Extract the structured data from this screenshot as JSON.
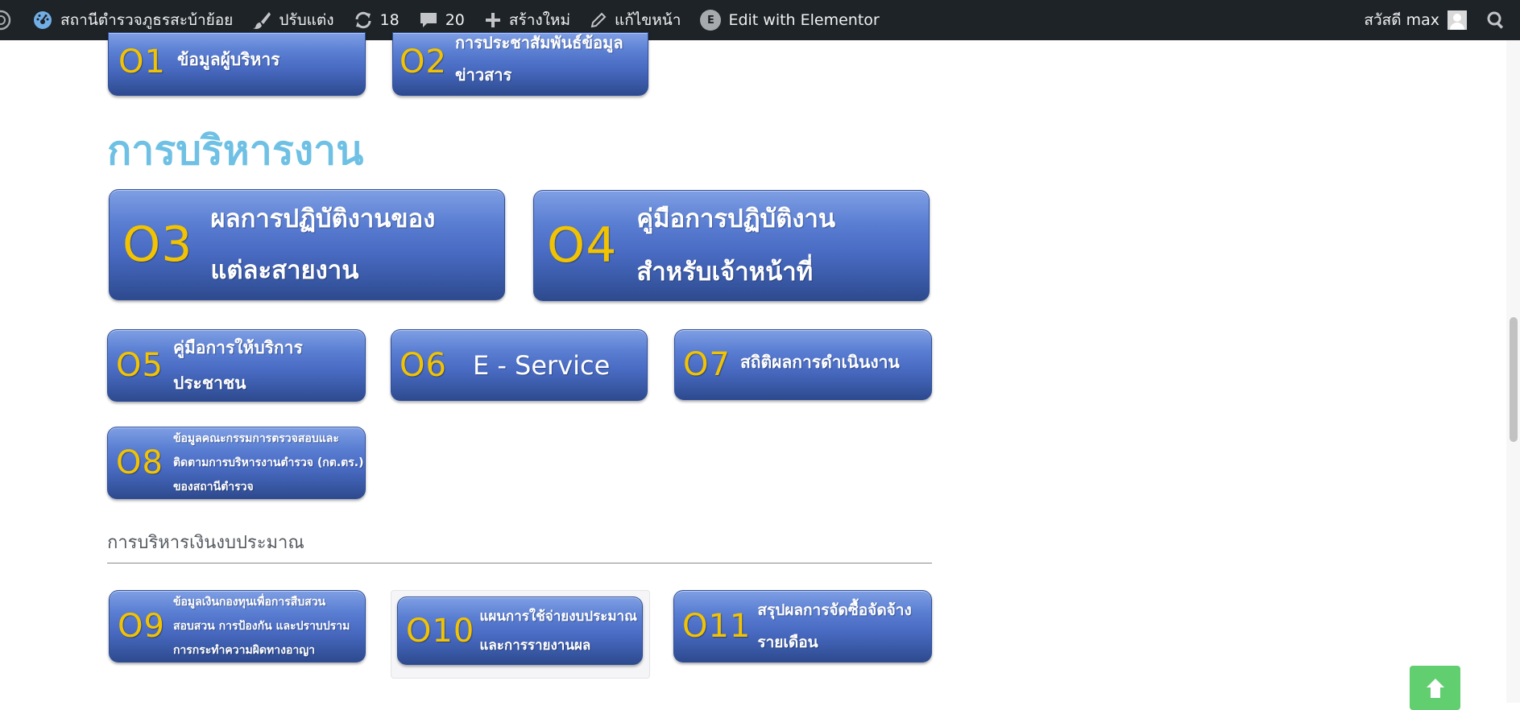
{
  "adminbar": {
    "site_name": "สถานีตำรวจภูธรสะบ้าย้อย",
    "customize": "ปรับแต่ง",
    "updates_count": "18",
    "comments_count": "20",
    "new": "สร้างใหม่",
    "edit_page": "แก้ไขหน้า",
    "elementor": "Edit with Elementor",
    "greeting": "สวัสดี max",
    "icons": [
      "wordpress-icon",
      "dashboard-icon",
      "brush-icon",
      "updates-icon",
      "comment-icon",
      "plus-icon",
      "pencil-icon",
      "elementor-icon",
      "avatar",
      "search-icon"
    ]
  },
  "top_tiles": [
    {
      "code": "O1",
      "label": "ข้อมูลผู้บริหาร"
    },
    {
      "code": "O2",
      "label_line1": "การประชาสัมพันธ์ข้อมูล",
      "label_line2": "ข่าวสาร"
    }
  ],
  "section": {
    "title": "การบริหารงาน"
  },
  "tiles": {
    "o3": {
      "code": "O3",
      "line1": "ผลการปฏิบัติงานของ",
      "line2": "แต่ละสายงาน"
    },
    "o4": {
      "code": "O4",
      "line1": "คู่มือการปฏิบัติงาน",
      "line2": "สำหรับเจ้าหน้าที่"
    },
    "o5": {
      "code": "O5",
      "line1": "คู่มือการให้บริการ",
      "line2": "ประชาชน"
    },
    "o6": {
      "code": "O6",
      "line1": "E - Service"
    },
    "o7": {
      "code": "O7",
      "line1": "สถิติผลการดำเนินงาน"
    },
    "o8": {
      "code": "O8",
      "line1": "ข้อมูลคณะกรรมการตรวจสอบและ",
      "line2": "ติดตามการบริหารงานตำรวจ (กต.ตร.)",
      "line3": "ของสถานีตำรวจ"
    }
  },
  "budget": {
    "heading": "การบริหารเงินงบประมาณ",
    "o9": {
      "code": "O9",
      "line1": "ข้อมูลเงินกองทุนเพื่อการสืบสวน",
      "line2": "สอบสวน การป้องกัน และปราบปราม",
      "line3": "การกระทำความผิดทางอาญา"
    },
    "o10": {
      "code": "O10",
      "line1": "แผนการใช้จ่ายงบประมาณ",
      "line2": "และการรายงานผล"
    },
    "o11": {
      "code": "O11",
      "line1": "สรุปผลการจัดซื้อจัดจ้าง",
      "line2": "รายเดือน"
    }
  },
  "colors": {
    "tile_gradient_top": "#7f9fe4",
    "tile_gradient_bottom": "#2e4a8e",
    "code_yellow": "#f2c300",
    "section_title": "#6ec1e4",
    "back_to_top": "#61ce70",
    "adminbar": "#1d2327"
  }
}
